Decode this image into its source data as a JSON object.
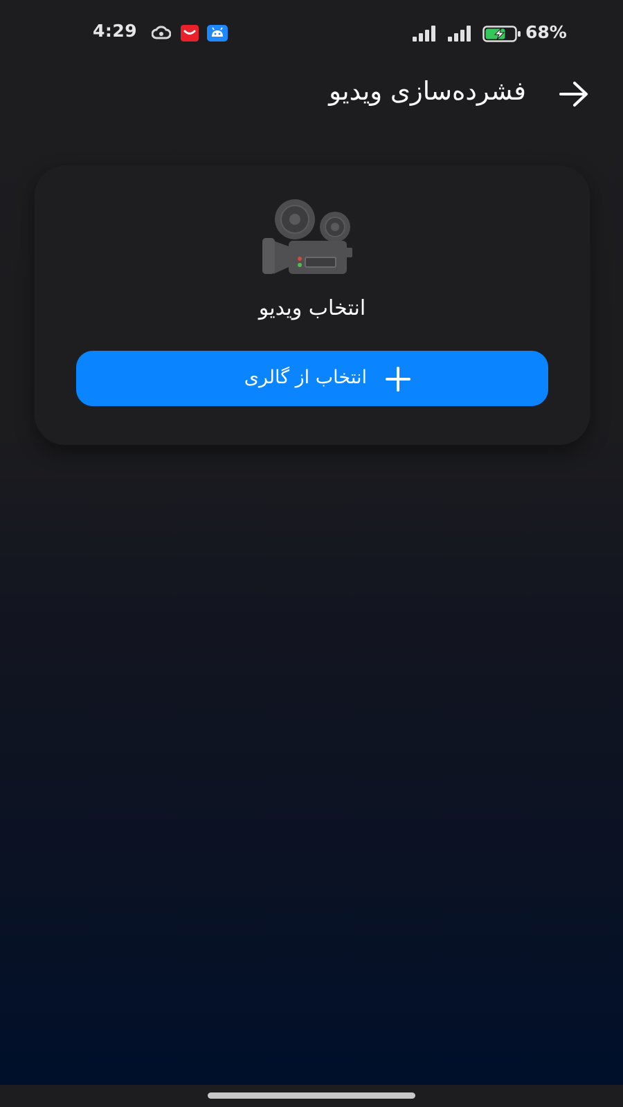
{
  "status_bar": {
    "time": "4:29",
    "battery_percent": "68%",
    "battery_level": 0.68,
    "notification_icons": [
      "cloud-icon",
      "red-app-icon",
      "android-app-icon"
    ],
    "signal_icons": [
      "signal-bars-icon",
      "signal-bars-icon"
    ]
  },
  "header": {
    "title": "فشرده‌سازی ویدیو",
    "back_icon": "arrow-right-icon"
  },
  "card": {
    "icon": "movie-camera-icon",
    "label": "انتخاب ویدیو",
    "button": {
      "label": "انتخاب از گالری",
      "icon": "plus-icon"
    }
  },
  "colors": {
    "accent": "#0a84ff",
    "background_top": "#1d1d20",
    "background_bottom": "#00102a",
    "card": "#1e1e21"
  }
}
